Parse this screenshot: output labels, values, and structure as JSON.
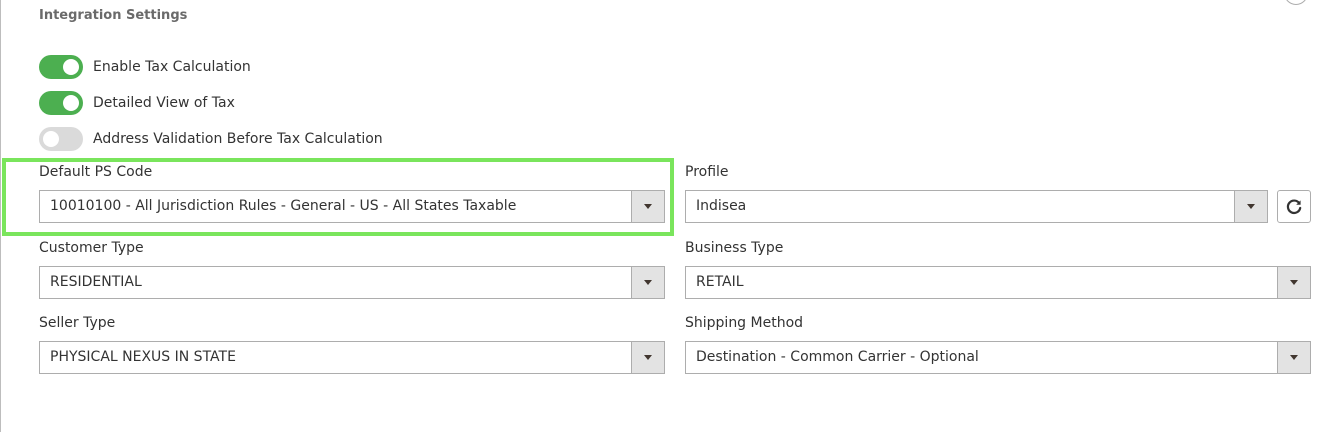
{
  "section": {
    "title": "Integration Settings"
  },
  "toggles": [
    {
      "label": "Enable Tax Calculation",
      "state": "on"
    },
    {
      "label": "Detailed View of Tax",
      "state": "on"
    },
    {
      "label": "Address Validation Before Tax Calculation",
      "state": "off"
    }
  ],
  "fields": {
    "default_ps_code": {
      "label": "Default PS Code",
      "value": "10010100 - All Jurisdiction Rules - General - US - All States Taxable"
    },
    "profile": {
      "label": "Profile",
      "value": "Indisea"
    },
    "customer_type": {
      "label": "Customer Type",
      "value": "RESIDENTIAL"
    },
    "business_type": {
      "label": "Business Type",
      "value": "RETAIL"
    },
    "seller_type": {
      "label": "Seller Type",
      "value": "PHYSICAL NEXUS IN STATE"
    },
    "shipping_method": {
      "label": "Shipping Method",
      "value": "Destination - Common Carrier - Optional"
    }
  },
  "icons": {
    "refresh": "refresh-icon",
    "dropdown": "chevron-down-icon"
  },
  "colors": {
    "toggle_on": "#4caf50",
    "toggle_off": "#dadada",
    "highlight": "#7ae55c"
  }
}
